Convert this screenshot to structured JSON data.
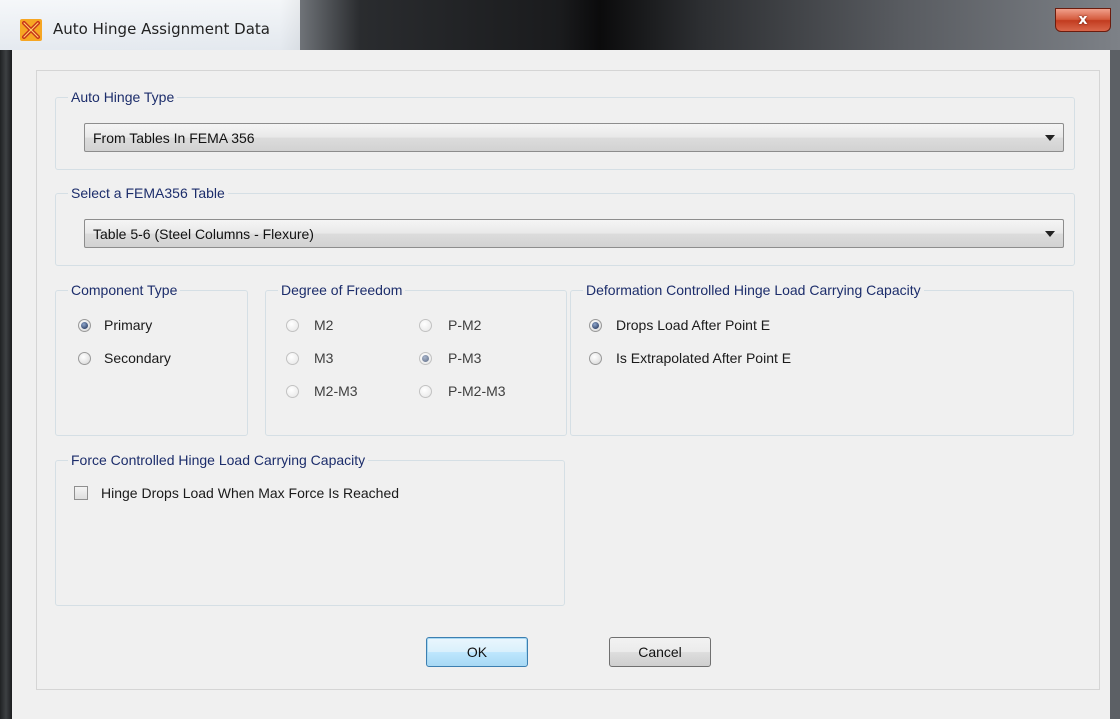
{
  "window": {
    "title": "Auto Hinge Assignment Data",
    "close_label": "x"
  },
  "auto_hinge_type": {
    "label": "Auto Hinge Type",
    "selected": "From Tables In FEMA 356"
  },
  "fema_table": {
    "label": "Select a FEMA356 Table",
    "selected": "Table 5-6 (Steel Columns - Flexure)"
  },
  "component_type": {
    "label": "Component Type",
    "options": [
      {
        "label": "Primary",
        "checked": true
      },
      {
        "label": "Secondary",
        "checked": false
      }
    ]
  },
  "degree_of_freedom": {
    "label": "Degree of Freedom",
    "options": [
      {
        "label": "M2",
        "checked": false
      },
      {
        "label": "M3",
        "checked": false
      },
      {
        "label": "M2-M3",
        "checked": false
      },
      {
        "label": "P-M2",
        "checked": false
      },
      {
        "label": "P-M3",
        "checked": true
      },
      {
        "label": "P-M2-M3",
        "checked": false
      }
    ]
  },
  "deformation_controlled": {
    "label": "Deformation Controlled Hinge Load Carrying Capacity",
    "options": [
      {
        "label": "Drops Load After Point E",
        "checked": true
      },
      {
        "label": "Is Extrapolated After Point E",
        "checked": false
      }
    ]
  },
  "force_controlled": {
    "label": "Force Controlled Hinge Load Carrying Capacity",
    "checkbox_label": "Hinge Drops Load When Max Force Is Reached",
    "checked": false
  },
  "buttons": {
    "ok": "OK",
    "cancel": "Cancel"
  },
  "colors": {
    "group_label": "#1c2d6b",
    "dialog_bg": "#f0f0f0",
    "close_button": "#c23b1f",
    "default_button_border": "#3c7fb1"
  }
}
